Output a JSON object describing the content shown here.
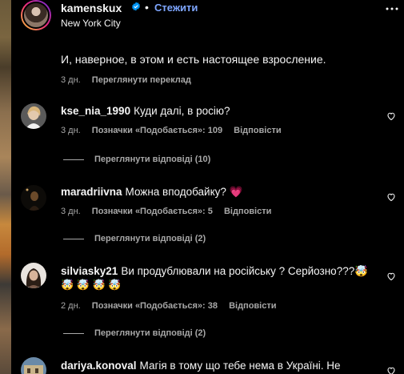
{
  "post": {
    "username": "kamenskux",
    "follow_label": "Стежити",
    "separator": "•",
    "location": "New York City",
    "caption": "И, наверное, в этом и есть настоящее взросление.",
    "caption_age": "3 дн.",
    "see_translation": "Переглянути переклад"
  },
  "comments": [
    {
      "username": "kse_nia_1990",
      "text": "Куди далі, в росію?",
      "age": "3 дн.",
      "likes": "Позначки «Подобається»: 109",
      "reply_label": "Відповісти",
      "view_replies": "Переглянути відповіді (10)"
    },
    {
      "username": "maradriivna",
      "text": "Можна вподобайку? 💗",
      "age": "3 дн.",
      "likes": "Позначки «Подобається»: 5",
      "reply_label": "Відповісти",
      "view_replies": "Переглянути відповіді (2)"
    },
    {
      "username": "silviasky21",
      "text": "Ви продублювали на російську ? Серйозно???🤯",
      "text_line2": "🤯 🤯 🤯 🤯",
      "age": "2 дн.",
      "likes": "Позначки «Подобається»: 38",
      "reply_label": "Відповісти",
      "view_replies": "Переглянути відповіді (2)"
    },
    {
      "username": "dariya.konoval",
      "text": "Магія в тому що тебе нема в Україні. Не"
    }
  ],
  "icons": {
    "verified": "verified-badge-icon",
    "heart": "heart-icon",
    "more": "more-options-icon"
  },
  "colors": {
    "background": "#000000",
    "text": "#f5f5f5",
    "muted": "#a8a8a8",
    "link": "#7ea6ff",
    "verified": "#0095f6"
  }
}
